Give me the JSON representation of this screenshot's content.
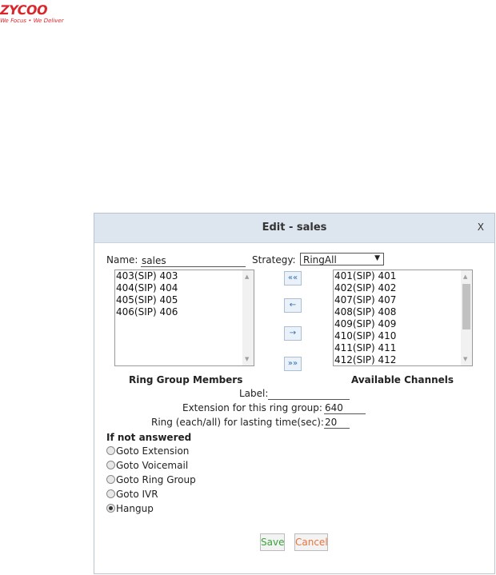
{
  "brand": {
    "logo_text": "ZYCOO",
    "tagline": "We Focus • We Deliver"
  },
  "dialog": {
    "title": "Edit - sales",
    "close_label": "X",
    "name": {
      "label": "Name:",
      "value": "sales"
    },
    "strategy": {
      "label": "Strategy:",
      "selected": "RingAll"
    },
    "members": {
      "caption": "Ring Group Members",
      "items": [
        "403(SIP) 403",
        "404(SIP) 404",
        "405(SIP) 405",
        "406(SIP) 406"
      ]
    },
    "available": {
      "caption": "Available Channels",
      "items": [
        "401(SIP) 401",
        "402(SIP) 402",
        "407(SIP) 407",
        "408(SIP) 408",
        "409(SIP) 409",
        "410(SIP) 410",
        "411(SIP) 411",
        "412(SIP) 412"
      ]
    },
    "move_buttons": {
      "add_all": "«",
      "move_left": "←",
      "move_right": "→",
      "remove_all": "»"
    },
    "label_field": {
      "label": "Label:",
      "value": ""
    },
    "extension": {
      "label": "Extension for this ring group:",
      "value": "640"
    },
    "ring_time": {
      "label": "Ring (each/all) for lasting time(sec):",
      "value": "20"
    },
    "not_answered": {
      "heading": "If not answered",
      "options": [
        "Goto Extension",
        "Goto Voicemail",
        "Goto Ring Group",
        "Goto IVR",
        "Hangup"
      ],
      "selected": "Hangup"
    },
    "save_label": "Save",
    "cancel_label": "Cancel"
  },
  "colors": {
    "header_bg": "#dde6ef",
    "brand_red": "#d9262c",
    "save_green": "#3aa33a",
    "cancel_orange": "#e8743b"
  }
}
